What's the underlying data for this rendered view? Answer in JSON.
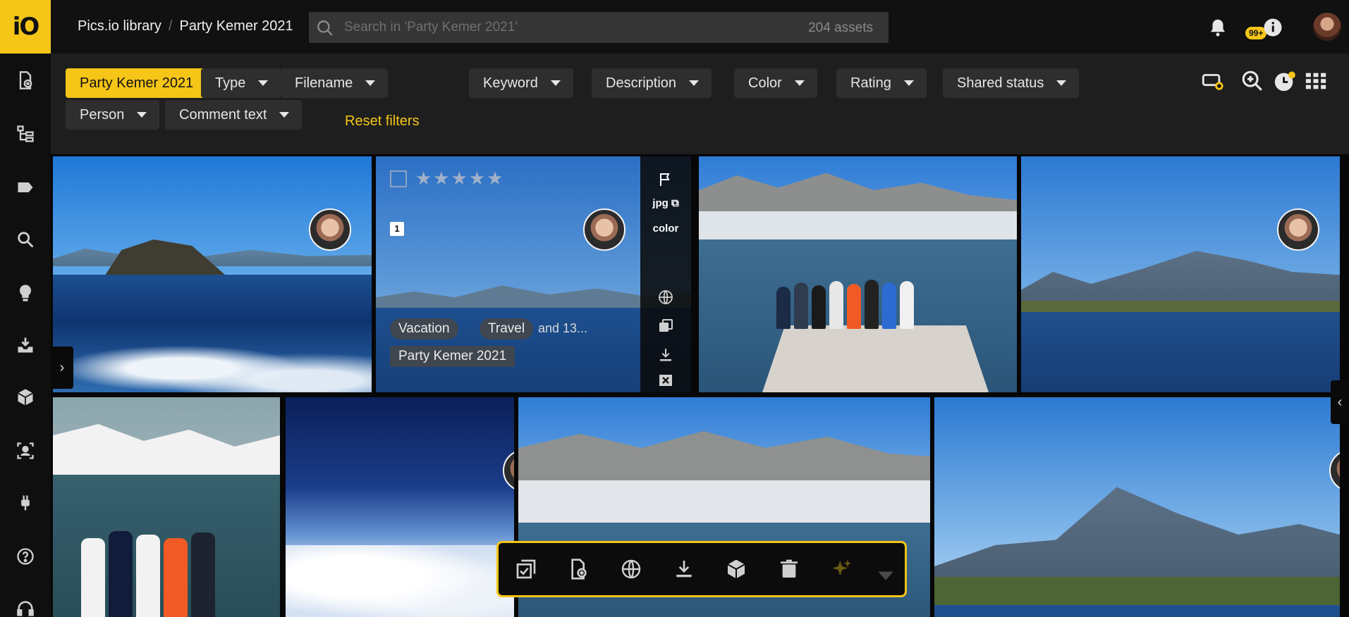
{
  "app": {
    "logo_text": "iO"
  },
  "breadcrumb": {
    "root": "Pics.io library",
    "separator": "/",
    "current": "Party Kemer 2021"
  },
  "search": {
    "placeholder": "Search in 'Party Kemer 2021'",
    "value": "",
    "asset_count": "204 assets"
  },
  "header": {
    "notifications_badge": "99+"
  },
  "filters": {
    "active_chip": "Party Kemer 2021",
    "chips": [
      "Type",
      "Filename",
      "Keyword",
      "Description",
      "Color",
      "Rating",
      "Shared status",
      "Person",
      "Comment text"
    ],
    "reset_label": "Reset filters"
  },
  "hovered_asset": {
    "file_ext": "jpg",
    "color_label": "color",
    "comment_count": "1",
    "tags": [
      "Vacation",
      "Travel"
    ],
    "tags_more": "and 13...",
    "collection": "Party Kemer 2021",
    "rating": 0
  },
  "colors": {
    "accent": "#f5c518",
    "background": "#141414",
    "chip": "#2e2e2e"
  },
  "icons": {
    "rail": [
      "add-file-icon",
      "tree-icon",
      "tag-icon",
      "search-zoom-icon",
      "lightbulb-icon",
      "import-icon",
      "box-icon",
      "person-icon",
      "plug-icon",
      "help-icon",
      "headset-icon"
    ],
    "toolbar": [
      "select-all-icon",
      "add-file-icon",
      "globe-icon",
      "download-icon",
      "box-icon",
      "trash-icon",
      "sparkle-icon",
      "chevron-down-icon"
    ]
  }
}
